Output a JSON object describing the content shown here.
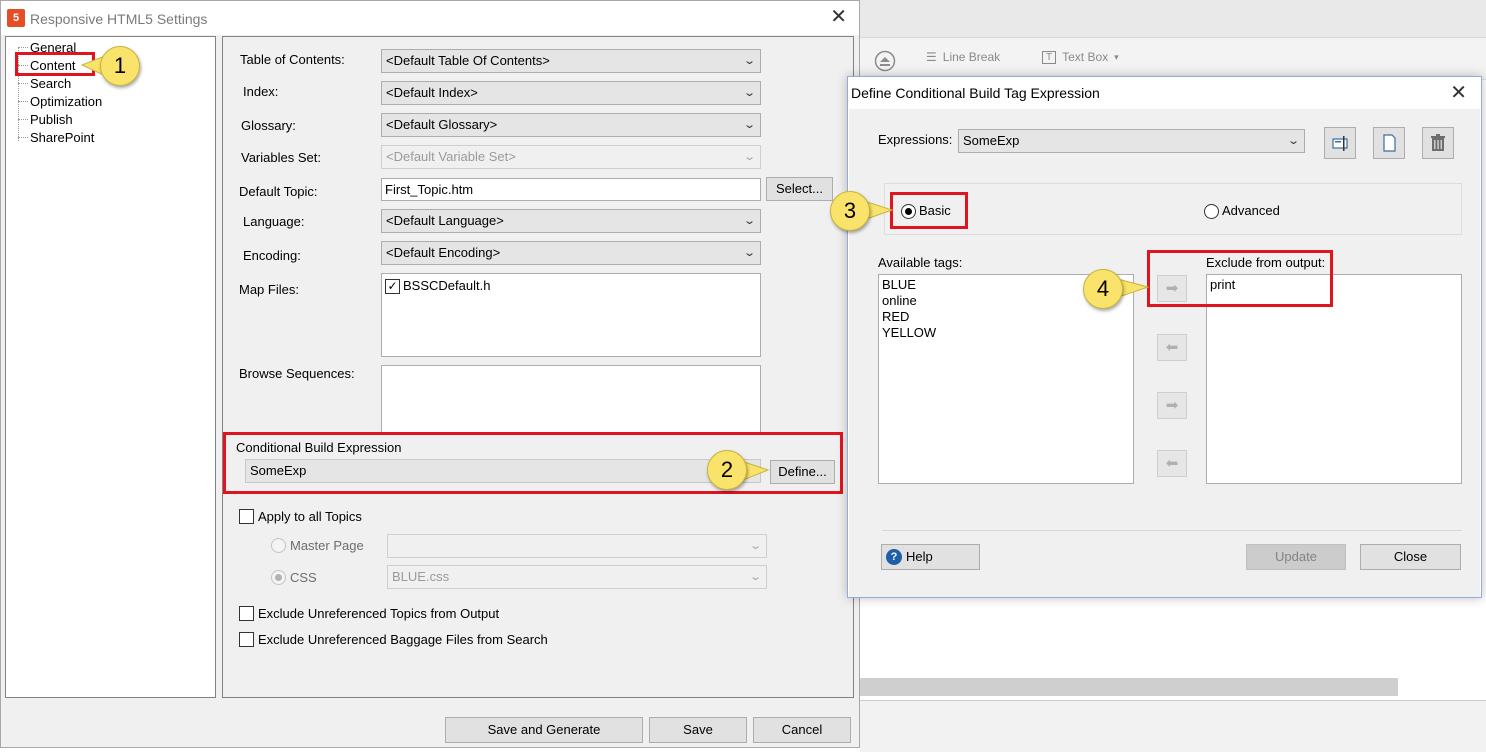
{
  "background_app": {
    "toolbar": {
      "line_break": "Line Break",
      "text_box": "Text Box"
    }
  },
  "window": {
    "title": "Responsive HTML5 Settings",
    "icon": "html5-icon",
    "close_glyph": "✕",
    "tree": [
      "General",
      "Content",
      "Search",
      "Optimization",
      "Publish",
      "SharePoint"
    ],
    "selected_tree_item": "Content",
    "fields": {
      "toc_label": "Table of Contents:",
      "toc_value": "<Default Table Of Contents>",
      "index_label": "Index:",
      "index_value": "<Default Index>",
      "glossary_label": "Glossary:",
      "glossary_value": "<Default Glossary>",
      "variables_label": "Variables Set:",
      "variables_value": "<Default Variable Set>",
      "default_topic_label": "Default Topic:",
      "default_topic_value": "First_Topic.htm",
      "select_button": "Select...",
      "language_label": "Language:",
      "language_value": "<Default Language>",
      "encoding_label": "Encoding:",
      "encoding_value": "<Default Encoding>",
      "map_files_label": "Map Files:",
      "map_files": [
        {
          "name": "BSSCDefault.h",
          "checked": true
        }
      ],
      "browse_label": "Browse Sequences:",
      "cbe_label": "Conditional Build Expression",
      "cbe_value": "SomeExp",
      "define_button": "Define...",
      "apply_all_label": "Apply to all Topics",
      "master_page_label": "Master Page",
      "css_label": "CSS",
      "css_value": "BLUE.css",
      "exclude_topics_label": "Exclude Unreferenced Topics from Output",
      "exclude_baggage_label": "Exclude Unreferenced Baggage Files from Search"
    },
    "buttons": {
      "save_generate": "Save and Generate",
      "save": "Save",
      "cancel": "Cancel"
    }
  },
  "dialog": {
    "title": "Define Conditional Build Tag Expression",
    "close_glyph": "✕",
    "expressions_label": "Expressions:",
    "expressions_value": "SomeExp",
    "mode_basic": "Basic",
    "mode_advanced": "Advanced",
    "selected_mode": "Basic",
    "available_label": "Available tags:",
    "available_tags": [
      "BLUE",
      "online",
      "RED",
      "YELLOW"
    ],
    "exclude_label": "Exclude from output:",
    "exclude_tags": [
      "print"
    ],
    "help_button": "Help",
    "update_button": "Update",
    "close_button": "Close"
  },
  "callouts": [
    "1",
    "2",
    "3",
    "4"
  ],
  "colors": {
    "highlight_red": "#e0141e",
    "callout_yellow": "#fae36a",
    "html5_orange": "#e44d26"
  }
}
